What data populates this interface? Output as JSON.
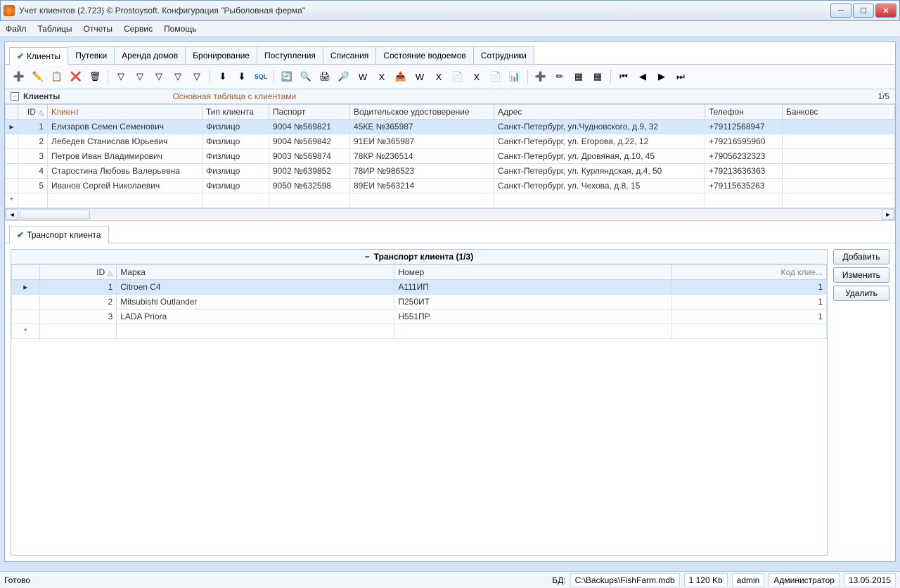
{
  "window": {
    "title": "Учет клиентов (2.723) © Prostoysoft. Конфигурация \"Рыболовная ферма\""
  },
  "menu": {
    "file": "Файл",
    "tables": "Таблицы",
    "reports": "Отчеты",
    "service": "Сервис",
    "help": "Помощь"
  },
  "tabs": [
    {
      "label": "Клиенты",
      "active": true
    },
    {
      "label": "Путевки"
    },
    {
      "label": "Аренда домов"
    },
    {
      "label": "Бронирование"
    },
    {
      "label": "Поступления"
    },
    {
      "label": "Списания"
    },
    {
      "label": "Состояние водоемов"
    },
    {
      "label": "Сотрудники"
    }
  ],
  "section": {
    "name": "Клиенты",
    "desc": "Основная таблица с клиентами",
    "counter": "1/5"
  },
  "columns": {
    "id": "ID",
    "client": "Клиент",
    "type": "Тип клиента",
    "passport": "Паспорт",
    "license": "Водительское удостоверение",
    "address": "Адрес",
    "phone": "Телефон",
    "bank": "Банковс"
  },
  "rows": [
    {
      "id": "1",
      "client": "Елизаров Семен Семенович",
      "type": "Физлицо",
      "passport": "9004 №569821",
      "license": "45КЕ №365987",
      "address": "Санкт-Петербург, ул.Чудновского, д.9, 32",
      "phone": "+79112568947",
      "selected": true
    },
    {
      "id": "2",
      "client": "Лебедев Станислав Юрьевич",
      "type": "Физлицо",
      "passport": "9004 №569842",
      "license": "91ЕИ №365987",
      "address": "Санкт-Петербург, ул. Егорова, д.22, 12",
      "phone": "+79216595960"
    },
    {
      "id": "3",
      "client": "Петров Иван Владимирович",
      "type": "Физлицо",
      "passport": "9003 №569874",
      "license": "78КР №236514",
      "address": "Санкт-Петербург, ул. Дровяная, д.10, 45",
      "phone": "+79056232323"
    },
    {
      "id": "4",
      "client": "Старостина Любовь Валерьевна",
      "type": "Физлицо",
      "passport": "9002 №639852",
      "license": "78ИР №986523",
      "address": "Санкт-Петербург, ул. Курляндская, д.4, 50",
      "phone": "+79213636363"
    },
    {
      "id": "5",
      "client": "Иванов Сергей Николаевич",
      "type": "Физлицо",
      "passport": "9050 №632598",
      "license": "89ЕИ №563214",
      "address": "Санкт-Петербург, ул. Чехова, д.8, 15",
      "phone": "+79115635263"
    }
  ],
  "subtab": {
    "label": "Транспорт клиента"
  },
  "subsection": {
    "title": "Транспорт клиента (1/3)"
  },
  "subcolumns": {
    "id": "ID",
    "brand": "Марка",
    "number": "Номер",
    "clientcode": "Код клие..."
  },
  "subrows": [
    {
      "id": "1",
      "brand": "Citroen C4",
      "number": "А111ИП",
      "code": "1",
      "selected": true
    },
    {
      "id": "2",
      "brand": "Mitsubishi Outlander",
      "number": "П250ИТ",
      "code": "1"
    },
    {
      "id": "3",
      "brand": "LADA Priora",
      "number": "Н551ПР",
      "code": "1"
    }
  ],
  "sidebuttons": {
    "add": "Добавить",
    "edit": "Изменить",
    "delete": "Удалить"
  },
  "status": {
    "ready": "Готово",
    "db_label": "БД:",
    "db_path": "C:\\Backups\\FishFarm.mdb",
    "size": "1 120 Kb",
    "user": "admin",
    "role": "Администратор",
    "date": "13.05.2015"
  },
  "toolbar_icons": [
    "add-record-icon",
    "edit-record-icon",
    "copy-icon",
    "delete-icon",
    "clear-icon",
    "filter-icon",
    "filter-remove-icon",
    "filter-cancel-icon",
    "filter-edit-icon",
    "filter-save-icon",
    "group-icon",
    "ungroup-icon",
    "sql-icon",
    "refresh-icon",
    "find-icon",
    "print-icon",
    "preview-icon",
    "word-icon",
    "excel-icon",
    "export-icon",
    "import-word-icon",
    "import-excel-icon",
    "template-icon",
    "export-excel-icon",
    "export-template-icon",
    "chart-icon",
    "field-add-icon",
    "field-edit-icon",
    "table-icon",
    "table-edit-icon",
    "first-icon",
    "prev-icon",
    "next-icon",
    "last-icon"
  ],
  "toolbar_glyphs": [
    "➕",
    "✏️",
    "📋",
    "❌",
    "🗑",
    "▽",
    "▽",
    "▽",
    "▽",
    "▽",
    "⬇",
    "⬇",
    "SQL",
    "🔄",
    "🔍",
    "🖨",
    "🔎",
    "W",
    "X",
    "📤",
    "W",
    "X",
    "📄",
    "X",
    "📄",
    "📊",
    "➕",
    "✏",
    "▦",
    "▦",
    "⏮",
    "◀",
    "▶",
    "⏭"
  ]
}
